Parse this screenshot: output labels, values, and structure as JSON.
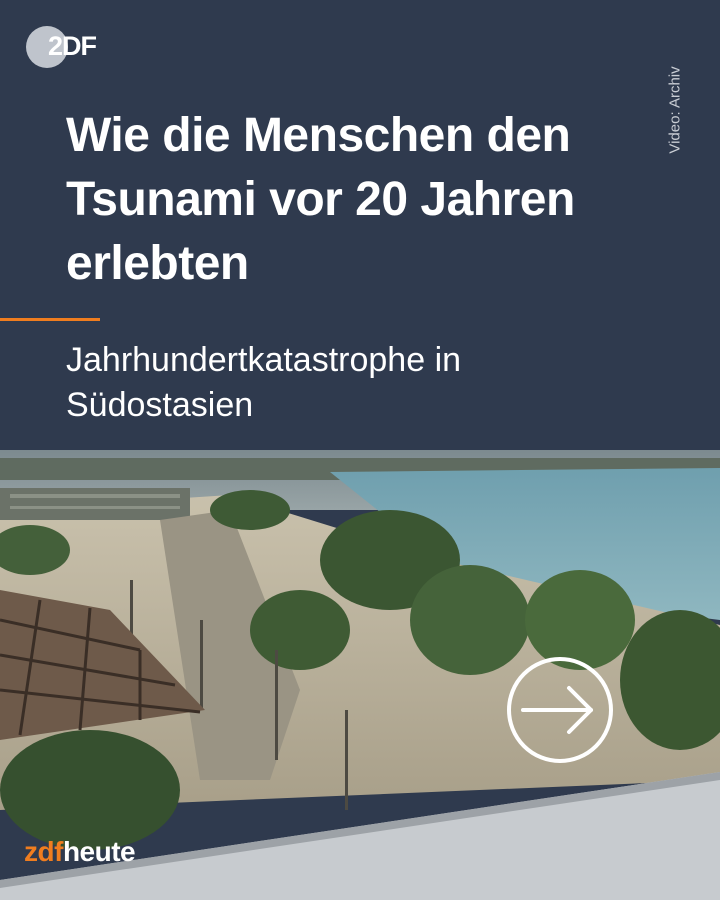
{
  "header": {
    "logo_text": "2DF",
    "credit": "Video: Archiv",
    "title": "Wie die Menschen den Tsunami vor 20 Jahren erlebten",
    "subtitle": "Jahrhundertkatastrophe in Südostasien"
  },
  "brand": {
    "zdf": "zdf",
    "heute": "heute"
  },
  "icons": {
    "play": "arrow-right-circle-icon"
  },
  "colors": {
    "header_bg": "#2f3a4e",
    "accent": "#f07d1f",
    "text": "#ffffff"
  }
}
